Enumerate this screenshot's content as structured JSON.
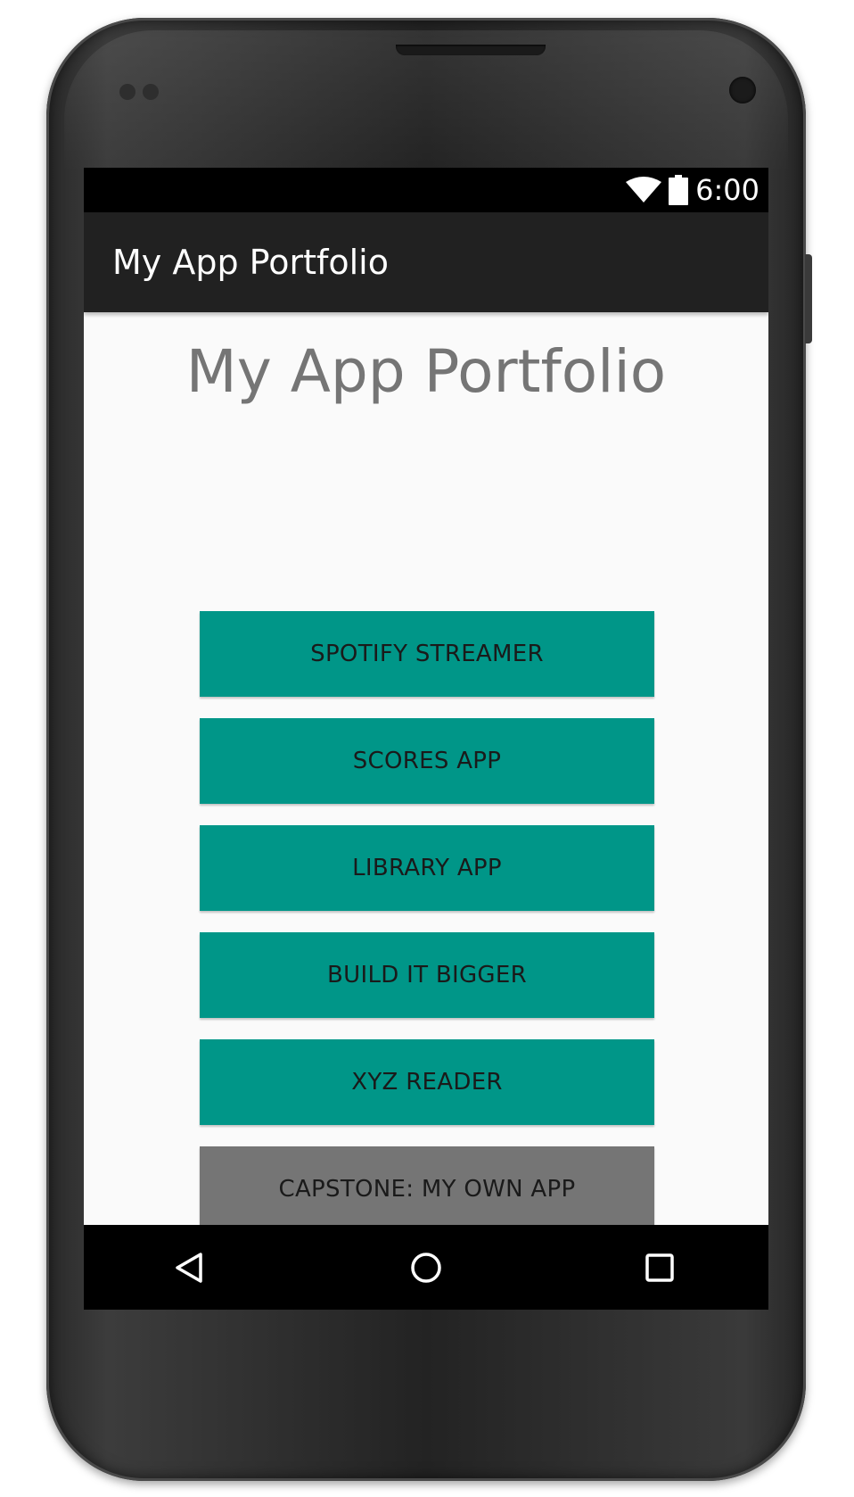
{
  "status_bar": {
    "time": "6:00",
    "icons": [
      "wifi-icon",
      "battery-icon"
    ]
  },
  "action_bar": {
    "title": "My App Portfolio"
  },
  "main": {
    "heading": "My App Portfolio",
    "buttons": [
      {
        "label": "SPOTIFY STREAMER",
        "color": "#009688"
      },
      {
        "label": "SCORES APP",
        "color": "#009688"
      },
      {
        "label": "LIBRARY APP",
        "color": "#009688"
      },
      {
        "label": "BUILD IT BIGGER",
        "color": "#009688"
      },
      {
        "label": "XYZ READER",
        "color": "#009688"
      },
      {
        "label": "CAPSTONE: MY OWN APP",
        "color": "#757575"
      }
    ]
  },
  "nav_bar": {
    "icons": [
      "back-icon",
      "home-icon",
      "recents-icon"
    ]
  },
  "colors": {
    "accent": "#009688",
    "secondary_button": "#757575",
    "action_bar": "#212121",
    "background": "#fafafa"
  }
}
